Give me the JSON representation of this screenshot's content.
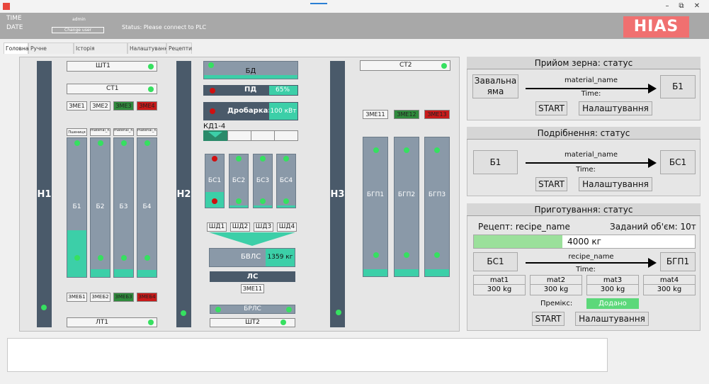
{
  "window": {
    "minimize": "–",
    "maximize": "⧉",
    "close": "✕"
  },
  "header": {
    "time_label": "TIME",
    "date_label": "DATE",
    "user": "admin",
    "change_user": "Change user",
    "status": "Status: Please connect to PLC",
    "logo": "HIAS"
  },
  "tabs": [
    "Головна",
    "Ручне керування",
    "Історія повідомлень",
    "Налаштування",
    "Рецепти"
  ],
  "plant": {
    "elevators": [
      "Н1",
      "Н2",
      "Н3"
    ],
    "sht1": "ШТ1",
    "st1": "СТ1",
    "st2": "СТ2",
    "lt1": "ЛТ1",
    "sht2": "ШТ2",
    "zme_top": [
      "ЗМЕ1",
      "ЗМЕ2",
      "ЗМЕ3",
      "ЗМЕ4"
    ],
    "zme_bottom": [
      "ЗМЕБ1",
      "ЗМЕБ2",
      "ЗМЕБ3",
      "ЗМЕБ4"
    ],
    "zme_right": [
      "ЗМЕ11",
      "ЗМЕ12",
      "ЗМЕ13"
    ],
    "bin_heads": [
      "Пшениця",
      "material_name",
      "material_name",
      "material_name"
    ],
    "bins": [
      "Б1",
      "Б2",
      "Б3",
      "Б4"
    ],
    "bd": "БД",
    "pd": "ПД",
    "pd_value": "65%",
    "crusher": "Дробарка:",
    "crusher_power": "100 кВт",
    "kd": "КД1-4",
    "bs": [
      "БС1",
      "БС2",
      "БС3",
      "БС4"
    ],
    "shd": [
      "ШД1",
      "ШД2",
      "ШД3",
      "ШД4"
    ],
    "bvls": "БВЛС",
    "bvls_value": "1359 кг",
    "ls": "ЛС",
    "zme11": "ЗМЕ11",
    "brls": "БРЛС",
    "bgp": [
      "БГП1",
      "БГП2",
      "БГП3"
    ]
  },
  "grain_intake": {
    "title": "Прийом зерна: статус",
    "source": "Завальна яма",
    "material": "material_name",
    "time": "Time:",
    "dest": "Б1",
    "start": "START",
    "settings": "Налаштування"
  },
  "grinding": {
    "title": "Подрібнення: статус",
    "source": "Б1",
    "material": "material_name",
    "time": "Time:",
    "dest": "БС1",
    "start": "START",
    "settings": "Налаштування"
  },
  "preparation": {
    "title": "Приготування: статус",
    "recipe": "Рецепт: recipe_name",
    "volume": "Заданий об'єм: 10т",
    "progress_text": "4000 кг",
    "progress_fraction": 0.4,
    "source": "БС1",
    "recipe_name": "recipe_name",
    "time": "Time:",
    "dest": "БГП1",
    "materials": [
      {
        "name": "mat1",
        "value": "300 kg"
      },
      {
        "name": "mat2",
        "value": "300 kg"
      },
      {
        "name": "mat3",
        "value": "300 kg"
      },
      {
        "name": "mat4",
        "value": "300 kg"
      }
    ],
    "premix_label": "Премікс:",
    "premix_value": "Додано",
    "start": "START",
    "settings": "Налаштування"
  },
  "colors": {
    "accent_green": "#3ccfa8",
    "alarm_red": "#c81a1a",
    "ok_green": "#36e060",
    "logo": "#f07070"
  }
}
